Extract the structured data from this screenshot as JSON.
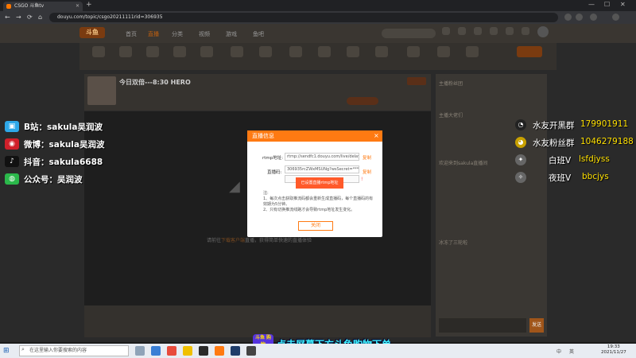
{
  "browser": {
    "tab_title": "CSGO 斗鱼tv",
    "new_tab": "+",
    "url": "douyu.com/topic/csgo20211111rid=306935",
    "min": "—",
    "max": "☐",
    "close": "✕",
    "back": "←",
    "forward": "→",
    "reload": "⟳",
    "home": "⌂"
  },
  "site": {
    "logo": "斗鱼",
    "nav": [
      {
        "label": "首页"
      },
      {
        "label": "直播",
        "active": true
      },
      {
        "label": "分类"
      },
      {
        "label": "视频"
      },
      {
        "label": "游戏"
      },
      {
        "label": "鱼吧"
      }
    ],
    "room_title": "今日双倍---8:30 HERO",
    "player_hint_pre": "请前往",
    "player_hint_link": "下载客户端",
    "player_hint_post": "直播，获得简单快速的直播体验"
  },
  "chat_lines": [
    "主播粉丝团",
    "主播大佬们",
    "欢迎来到sakula直播间",
    "冰冻了三轮啦"
  ],
  "chat_send": "发送",
  "modal": {
    "title": "直播信息",
    "close": "×",
    "rtmp_label": "rtmp地址:",
    "rtmp_value": "rtmp://sendfc1.douyu.com/live/delay",
    "rtmp_copy": "复制",
    "code_label": "直播码:",
    "code_value": "306935rcZWxMSUNg?wsSecret=*******",
    "code_copy": "复制",
    "mode_button": "已设置直播rtmp地址",
    "mode_warn": "!",
    "notes": "注:\n1、每次点击获取推流码都会重新生成直播码，每个直播码的有效期为5分钟。\n2、只有切换推流线路才会导致rtmp地址发生变化。",
    "close_button": "关闭"
  },
  "social": [
    {
      "icon": "bilibili-icon",
      "glyph": "▣",
      "color": "#2ea8e8",
      "text": "B站：sakula吴润波"
    },
    {
      "icon": "weibo-icon",
      "glyph": "◉",
      "color": "#d0202a",
      "text": "微博：sakula吴润波"
    },
    {
      "icon": "douyin-icon",
      "glyph": "♪",
      "color": "#111111",
      "text": "抖音：sakula6688"
    },
    {
      "icon": "wechat-icon",
      "glyph": "◍",
      "color": "#2bb84b",
      "text": "公众号：吴润波"
    }
  ],
  "groups": [
    {
      "icon": "qq-icon",
      "glyph": "◔",
      "color": "#222",
      "label": "水友开黑群",
      "value": "179901911"
    },
    {
      "icon": "qq-fan-icon",
      "glyph": "◕",
      "color": "#c8a000",
      "label": "水友粉丝群",
      "value": "1046279188"
    },
    {
      "icon": "knife-icon",
      "glyph": "✦",
      "color": "#666",
      "label": "白班V",
      "value": "lsfdjyss"
    },
    {
      "icon": "knife-icon",
      "glyph": "✧",
      "color": "#666",
      "label": "夜班V",
      "value": "bbcjys"
    }
  ],
  "subtitle": {
    "badge": "斗鱼 购物",
    "text": "点击屏幕下方斗鱼购物下单"
  },
  "taskbar": {
    "start": "⊞",
    "search_placeholder": "在这里输入你要搜索的内容",
    "search_glyph": "⌕",
    "time": "19:33",
    "date": "2021/11/27",
    "ime": "中",
    "lang": "英"
  }
}
